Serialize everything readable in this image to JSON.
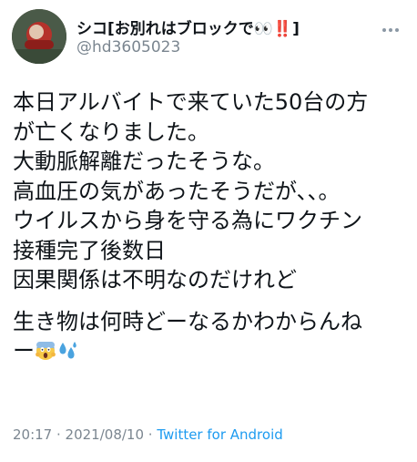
{
  "user": {
    "display_name": "シコ[お別れはブロックで👀‼️]",
    "handle": "@hd3605023"
  },
  "tweet": {
    "lines_1": [
      "本日アルバイトで来ていた50台の方",
      "が亡くなりました。",
      "大動脈解離だったそうな。",
      "高血圧の気があったそうだが、、。",
      "ウイルスから身を守る為にワクチン",
      "接種完了後数日",
      "因果関係は不明なのだけれど"
    ],
    "line_8": "生き物は何時どーなるかわからんね",
    "line_9_prefix": "ー",
    "emoji_1": "face-screaming-in-fear-icon",
    "emoji_2": "sweat-droplets-icon"
  },
  "footer": {
    "time": "20:17",
    "separator_1": " · ",
    "date": "2021/08/10",
    "separator_2": " · ",
    "source": "Twitter for Android"
  },
  "colors": {
    "text": "#0f1419",
    "secondary": "#7b8690",
    "link": "#1d9bf0"
  }
}
